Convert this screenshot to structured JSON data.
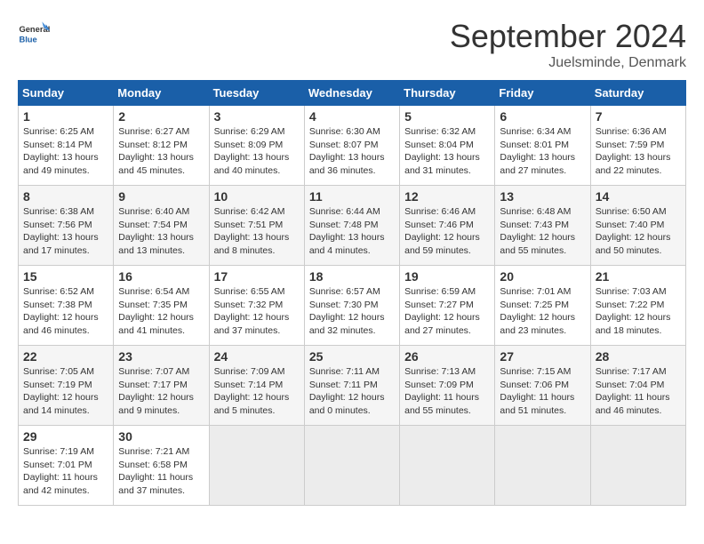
{
  "header": {
    "logo_general": "General",
    "logo_blue": "Blue",
    "month": "September 2024",
    "location": "Juelsminde, Denmark"
  },
  "weekdays": [
    "Sunday",
    "Monday",
    "Tuesday",
    "Wednesday",
    "Thursday",
    "Friday",
    "Saturday"
  ],
  "weeks": [
    [
      {
        "day": "1",
        "sunrise": "Sunrise: 6:25 AM",
        "sunset": "Sunset: 8:14 PM",
        "daylight": "Daylight: 13 hours and 49 minutes."
      },
      {
        "day": "2",
        "sunrise": "Sunrise: 6:27 AM",
        "sunset": "Sunset: 8:12 PM",
        "daylight": "Daylight: 13 hours and 45 minutes."
      },
      {
        "day": "3",
        "sunrise": "Sunrise: 6:29 AM",
        "sunset": "Sunset: 8:09 PM",
        "daylight": "Daylight: 13 hours and 40 minutes."
      },
      {
        "day": "4",
        "sunrise": "Sunrise: 6:30 AM",
        "sunset": "Sunset: 8:07 PM",
        "daylight": "Daylight: 13 hours and 36 minutes."
      },
      {
        "day": "5",
        "sunrise": "Sunrise: 6:32 AM",
        "sunset": "Sunset: 8:04 PM",
        "daylight": "Daylight: 13 hours and 31 minutes."
      },
      {
        "day": "6",
        "sunrise": "Sunrise: 6:34 AM",
        "sunset": "Sunset: 8:01 PM",
        "daylight": "Daylight: 13 hours and 27 minutes."
      },
      {
        "day": "7",
        "sunrise": "Sunrise: 6:36 AM",
        "sunset": "Sunset: 7:59 PM",
        "daylight": "Daylight: 13 hours and 22 minutes."
      }
    ],
    [
      {
        "day": "8",
        "sunrise": "Sunrise: 6:38 AM",
        "sunset": "Sunset: 7:56 PM",
        "daylight": "Daylight: 13 hours and 17 minutes."
      },
      {
        "day": "9",
        "sunrise": "Sunrise: 6:40 AM",
        "sunset": "Sunset: 7:54 PM",
        "daylight": "Daylight: 13 hours and 13 minutes."
      },
      {
        "day": "10",
        "sunrise": "Sunrise: 6:42 AM",
        "sunset": "Sunset: 7:51 PM",
        "daylight": "Daylight: 13 hours and 8 minutes."
      },
      {
        "day": "11",
        "sunrise": "Sunrise: 6:44 AM",
        "sunset": "Sunset: 7:48 PM",
        "daylight": "Daylight: 13 hours and 4 minutes."
      },
      {
        "day": "12",
        "sunrise": "Sunrise: 6:46 AM",
        "sunset": "Sunset: 7:46 PM",
        "daylight": "Daylight: 12 hours and 59 minutes."
      },
      {
        "day": "13",
        "sunrise": "Sunrise: 6:48 AM",
        "sunset": "Sunset: 7:43 PM",
        "daylight": "Daylight: 12 hours and 55 minutes."
      },
      {
        "day": "14",
        "sunrise": "Sunrise: 6:50 AM",
        "sunset": "Sunset: 7:40 PM",
        "daylight": "Daylight: 12 hours and 50 minutes."
      }
    ],
    [
      {
        "day": "15",
        "sunrise": "Sunrise: 6:52 AM",
        "sunset": "Sunset: 7:38 PM",
        "daylight": "Daylight: 12 hours and 46 minutes."
      },
      {
        "day": "16",
        "sunrise": "Sunrise: 6:54 AM",
        "sunset": "Sunset: 7:35 PM",
        "daylight": "Daylight: 12 hours and 41 minutes."
      },
      {
        "day": "17",
        "sunrise": "Sunrise: 6:55 AM",
        "sunset": "Sunset: 7:32 PM",
        "daylight": "Daylight: 12 hours and 37 minutes."
      },
      {
        "day": "18",
        "sunrise": "Sunrise: 6:57 AM",
        "sunset": "Sunset: 7:30 PM",
        "daylight": "Daylight: 12 hours and 32 minutes."
      },
      {
        "day": "19",
        "sunrise": "Sunrise: 6:59 AM",
        "sunset": "Sunset: 7:27 PM",
        "daylight": "Daylight: 12 hours and 27 minutes."
      },
      {
        "day": "20",
        "sunrise": "Sunrise: 7:01 AM",
        "sunset": "Sunset: 7:25 PM",
        "daylight": "Daylight: 12 hours and 23 minutes."
      },
      {
        "day": "21",
        "sunrise": "Sunrise: 7:03 AM",
        "sunset": "Sunset: 7:22 PM",
        "daylight": "Daylight: 12 hours and 18 minutes."
      }
    ],
    [
      {
        "day": "22",
        "sunrise": "Sunrise: 7:05 AM",
        "sunset": "Sunset: 7:19 PM",
        "daylight": "Daylight: 12 hours and 14 minutes."
      },
      {
        "day": "23",
        "sunrise": "Sunrise: 7:07 AM",
        "sunset": "Sunset: 7:17 PM",
        "daylight": "Daylight: 12 hours and 9 minutes."
      },
      {
        "day": "24",
        "sunrise": "Sunrise: 7:09 AM",
        "sunset": "Sunset: 7:14 PM",
        "daylight": "Daylight: 12 hours and 5 minutes."
      },
      {
        "day": "25",
        "sunrise": "Sunrise: 7:11 AM",
        "sunset": "Sunset: 7:11 PM",
        "daylight": "Daylight: 12 hours and 0 minutes."
      },
      {
        "day": "26",
        "sunrise": "Sunrise: 7:13 AM",
        "sunset": "Sunset: 7:09 PM",
        "daylight": "Daylight: 11 hours and 55 minutes."
      },
      {
        "day": "27",
        "sunrise": "Sunrise: 7:15 AM",
        "sunset": "Sunset: 7:06 PM",
        "daylight": "Daylight: 11 hours and 51 minutes."
      },
      {
        "day": "28",
        "sunrise": "Sunrise: 7:17 AM",
        "sunset": "Sunset: 7:04 PM",
        "daylight": "Daylight: 11 hours and 46 minutes."
      }
    ],
    [
      {
        "day": "29",
        "sunrise": "Sunrise: 7:19 AM",
        "sunset": "Sunset: 7:01 PM",
        "daylight": "Daylight: 11 hours and 42 minutes."
      },
      {
        "day": "30",
        "sunrise": "Sunrise: 7:21 AM",
        "sunset": "Sunset: 6:58 PM",
        "daylight": "Daylight: 11 hours and 37 minutes."
      },
      null,
      null,
      null,
      null,
      null
    ]
  ]
}
